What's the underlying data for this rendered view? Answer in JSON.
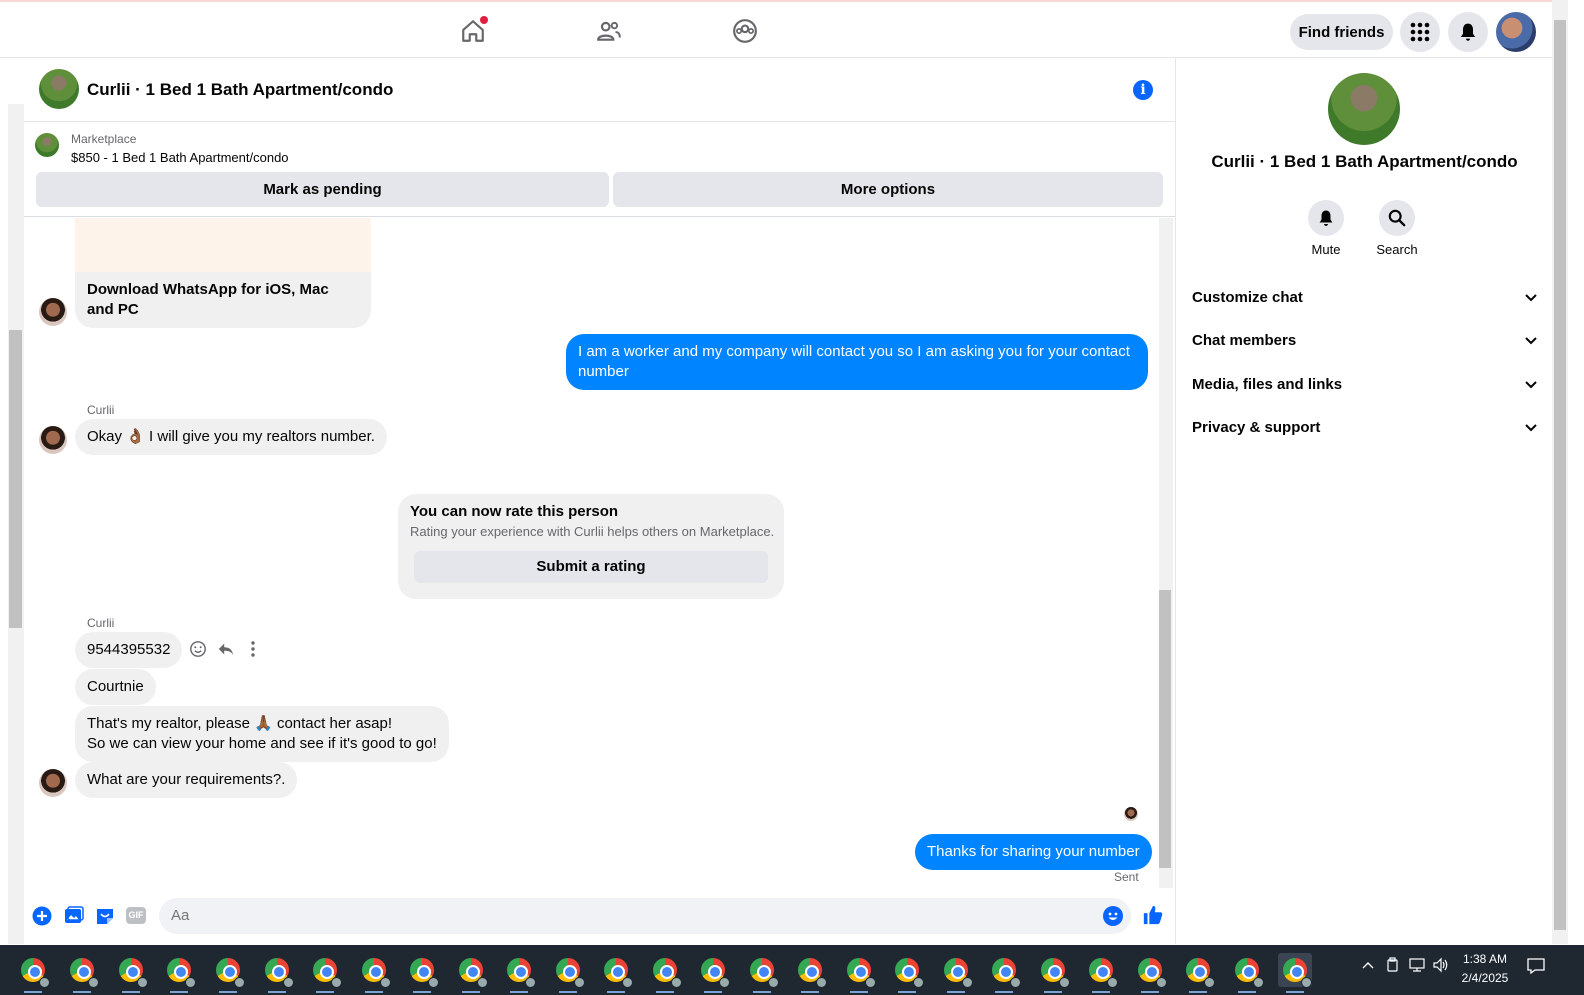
{
  "nav": {
    "find_friends": "Find friends"
  },
  "chat": {
    "title": "Curlii · 1 Bed 1 Bath Apartment/condo",
    "marketplace_label": "Marketplace",
    "listing": "$850 - 1 Bed 1 Bath Apartment/condo",
    "mark_pending": "Mark as pending",
    "more_options": "More options"
  },
  "messages": {
    "whatsapp": "Download WhatsApp for iOS, Mac and PC",
    "me_1": "I am a worker and my company will contact you so I am asking you for your contact number",
    "sender_1": "Curlii",
    "their_1": "Okay 👌🏾 I will give you my realtors number.",
    "rate_title": "You can now rate this person",
    "rate_sub": "Rating your experience with Curlii helps others on Marketplace.",
    "rate_btn": "Submit a rating",
    "sender_2": "Curlii",
    "their_2": "9544395532",
    "their_3": "Courtnie",
    "their_4a": "That's my realtor, please 🙏🏾 contact her asap!",
    "their_4b": "So we can view your home and see if it's good to go!",
    "their_5": "What are your requirements?.",
    "me_2": "Thanks for sharing your number",
    "status": "Sent"
  },
  "composer": {
    "placeholder": "Aa",
    "gif": "GIF"
  },
  "right_panel": {
    "title": "Curlii · 1 Bed 1 Bath Apartment/condo",
    "mute": "Mute",
    "search": "Search",
    "rows": [
      "Customize chat",
      "Chat members",
      "Media, files and links",
      "Privacy & support"
    ]
  },
  "taskbar": {
    "time": "1:38 AM",
    "date": "2/4/2025"
  },
  "colors": {
    "accent": "#0084ff",
    "bubble": "#f0f0f0",
    "taskbar": "#1f2731"
  }
}
